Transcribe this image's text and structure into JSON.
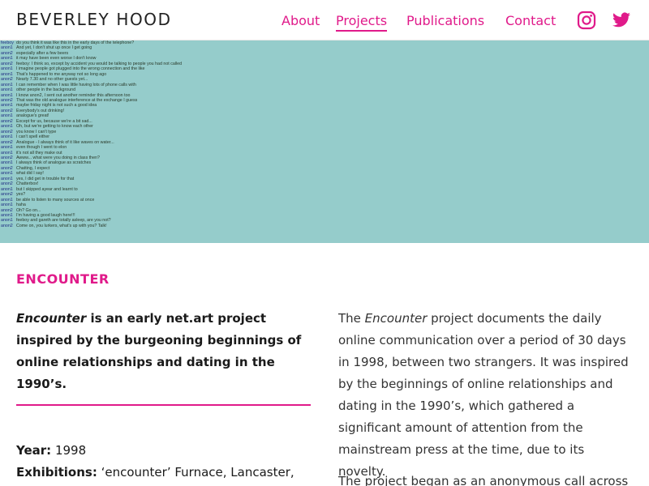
{
  "header": {
    "brand": "BEVERLEY HOOD",
    "nav": [
      "About",
      "Projects",
      "Publications",
      "Contact"
    ],
    "icons": [
      "instagram-icon",
      "twitter-icon"
    ],
    "accent_color": "#e01a8a"
  },
  "hero": {
    "background": "#95cccb",
    "chat": [
      {
        "who": "feeboy",
        "msg": "do you think it was like this in the early days of the telephone?"
      },
      {
        "who": "anon1",
        "msg": "And yet, I don't shut up once I get going"
      },
      {
        "who": "anon2",
        "msg": "especially after a few beers"
      },
      {
        "who": "anon1",
        "msg": "it may have been even worse I don't know"
      },
      {
        "who": "anon2",
        "msg": "feeboy: I think so, except by accident you would be talking to people you had not called"
      },
      {
        "who": "anon1",
        "msg": "I imagine people got plugged into the wrong connection and the like"
      },
      {
        "who": "anon1",
        "msg": "That's happened to me anyway not so long ago"
      },
      {
        "who": "anon2",
        "msg": "Nearly 7.30 and no other guests yet..."
      },
      {
        "who": "anon1",
        "msg": "I can remember when I was little having lots of phone calls with"
      },
      {
        "who": "anon1",
        "msg": "other people in the background"
      },
      {
        "who": "anon1",
        "msg": "I know anon2, I sent out another reminder this afternoon too"
      },
      {
        "who": "anon2",
        "msg": "That was the old analogue interference at the exchange I guess"
      },
      {
        "who": "anon1",
        "msg": "maybe friday night is not such a good idea"
      },
      {
        "who": "anon2",
        "msg": "Everybody's out drinking!"
      },
      {
        "who": "anon1",
        "msg": "analogue's great!"
      },
      {
        "who": "anon2",
        "msg": "Except for us, because we're a bit sad..."
      },
      {
        "who": "anon1",
        "msg": "Oh, but we're getting to know each other"
      },
      {
        "who": "anon2",
        "msg": "you know I can't type"
      },
      {
        "who": "anon1",
        "msg": "I can't spell either"
      },
      {
        "who": "anon2",
        "msg": "Analogue - I always think of it like waves on water..."
      },
      {
        "who": "anon1",
        "msg": "even though I went to elon"
      },
      {
        "who": "anon1",
        "msg": "it's not all they make out"
      },
      {
        "who": "anon2",
        "msg": "Awww... what were you doing in class then?"
      },
      {
        "who": "anon1",
        "msg": "I always think of analogue as scratches"
      },
      {
        "who": "anon2",
        "msg": "Chatting, I expect"
      },
      {
        "who": "anon1",
        "msg": "what did I say!"
      },
      {
        "who": "anon1",
        "msg": "yes, I did get in trouble for that"
      },
      {
        "who": "anon2",
        "msg": "Chatterbox!"
      },
      {
        "who": "anon1",
        "msg": "but I skipped ayear and learnt to"
      },
      {
        "who": "anon2",
        "msg": "yes?"
      },
      {
        "who": "anon1",
        "msg": "be able to listen to many sources at once"
      },
      {
        "who": "anon1",
        "msg": "haha"
      },
      {
        "who": "anon2",
        "msg": "Oh? Go on..."
      },
      {
        "who": "anon1",
        "msg": "I'm having a good laugh here!!!"
      },
      {
        "who": "anon1",
        "msg": "feeboy and gareth are totally asleep, are you not?"
      },
      {
        "who": "anon2",
        "msg": "Come on, you lurkers, what's up with you? Talk!"
      }
    ]
  },
  "content": {
    "title": "ENCOUNTER",
    "lead_em": "Encounter",
    "lead_rest": " is an early net.art project inspired by the burgeoning beginnings of online relationships and dating in the 1990’s.",
    "year_label": "Year:",
    "year_value": " 1998",
    "exh_label": "Exhibitions:",
    "exh_value": " ‘encounter’ Furnace, Lancaster,",
    "body_pre": "The ",
    "body_em": "Encounter",
    "body_post": " project documents the daily online communication over a period of 30 days in 1998, between two strangers. It was inspired by the beginnings of online relationships and dating in the 1990’s, which gathered a significant amount of attention from the mainstream press at the time, due to its novelty.",
    "para2": "The project began as an anonymous call across"
  }
}
